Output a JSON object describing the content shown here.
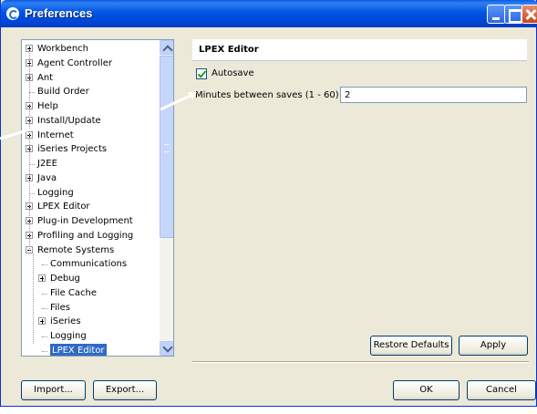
{
  "window": {
    "title": "Preferences"
  },
  "tree": {
    "items": [
      {
        "label": "Workbench",
        "expander": "plus",
        "level": 0
      },
      {
        "label": "Agent Controller",
        "expander": "plus",
        "level": 0
      },
      {
        "label": "Ant",
        "expander": "plus",
        "level": 0
      },
      {
        "label": "Build Order",
        "expander": "none",
        "level": 0
      },
      {
        "label": "Help",
        "expander": "plus",
        "level": 0
      },
      {
        "label": "Install/Update",
        "expander": "plus",
        "level": 0
      },
      {
        "label": "Internet",
        "expander": "plus",
        "level": 0
      },
      {
        "label": "iSeries Projects",
        "expander": "plus",
        "level": 0
      },
      {
        "label": "J2EE",
        "expander": "none",
        "level": 0
      },
      {
        "label": "Java",
        "expander": "plus",
        "level": 0
      },
      {
        "label": "Logging",
        "expander": "none",
        "level": 0
      },
      {
        "label": "LPEX Editor",
        "expander": "plus",
        "level": 0
      },
      {
        "label": "Plug-in Development",
        "expander": "plus",
        "level": 0
      },
      {
        "label": "Profiling and Logging",
        "expander": "plus",
        "level": 0
      },
      {
        "label": "Remote Systems",
        "expander": "minus",
        "level": 0
      },
      {
        "label": "Communications",
        "expander": "none",
        "level": 1
      },
      {
        "label": "Debug",
        "expander": "plus",
        "level": 1
      },
      {
        "label": "File Cache",
        "expander": "none",
        "level": 1
      },
      {
        "label": "Files",
        "expander": "none",
        "level": 1
      },
      {
        "label": "iSeries",
        "expander": "plus",
        "level": 1
      },
      {
        "label": "Logging",
        "expander": "none",
        "level": 1
      },
      {
        "label": "LPEX Editor",
        "expander": "none",
        "level": 1,
        "selected": true
      }
    ]
  },
  "page": {
    "title": "LPEX Editor",
    "autosave_label": "Autosave",
    "autosave_checked": true,
    "minutes_label": "Minutes between saves (1 - 60)",
    "minutes_value": "2",
    "restore_defaults_label": "Restore Defaults",
    "apply_label": "Apply"
  },
  "footer": {
    "import_label": "Import...",
    "export_label": "Export...",
    "ok_label": "OK",
    "cancel_label": "Cancel"
  },
  "colors": {
    "titlebar": "#0055e5",
    "selection": "#316ac5",
    "dialog_bg": "#ece9d8"
  }
}
